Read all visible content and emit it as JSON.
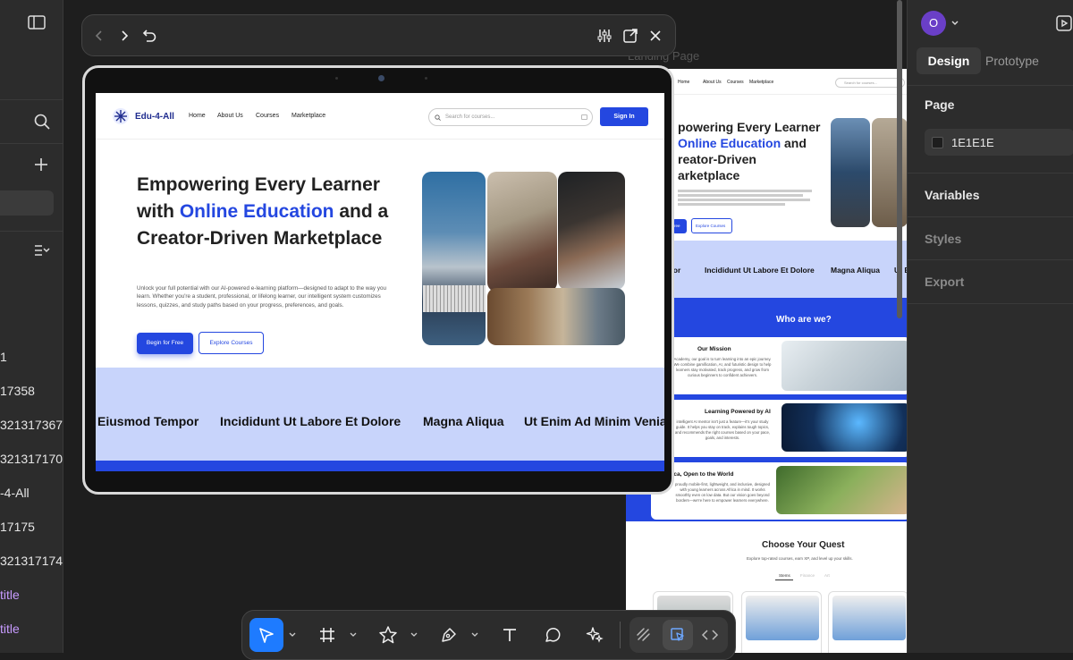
{
  "left_panel": {
    "layers": [
      {
        "label": "1",
        "purple": false
      },
      {
        "label": "17358",
        "purple": false
      },
      {
        "label": "321317367",
        "purple": false
      },
      {
        "label": "321317170",
        "purple": false
      },
      {
        "label": "-4-All",
        "purple": false
      },
      {
        "label": "17175",
        "purple": false
      },
      {
        "label": "321317174",
        "purple": false
      },
      {
        "label": "title",
        "purple": true
      },
      {
        "label": "title",
        "purple": true
      }
    ]
  },
  "device": {
    "site": {
      "logo": "Edu-4-All",
      "nav": [
        "Home",
        "About Us",
        "Courses",
        "Marketplace"
      ],
      "search_placeholder": "Search for courses...",
      "signin": "Sign In",
      "hero_title_part1": "Empowering Every Learner with ",
      "hero_title_accent": "Online Education",
      "hero_title_part2": " and a Creator-Driven Marketplace",
      "hero_desc": "Unlock your full potential with our AI-powered e-learning platform—designed to adapt to the way you learn. Whether you're a student, professional, or lifelong learner, our intelligent system customizes lessons, quizzes, and study paths based on your progress, preferences, and goals.",
      "btn_primary": "Begin for Free",
      "btn_secondary": "Explore Courses",
      "band": [
        "Eiusmod Tempor",
        "Incididunt Ut Labore Et Dolore",
        "Magna Aliqua",
        "Ut Enim Ad Minim Venia"
      ]
    }
  },
  "canvas": {
    "frame_label": "Landing Page",
    "preview": {
      "nav": [
        "Home",
        "About Us",
        "Courses",
        "Marketplace"
      ],
      "search_placeholder": "Search for courses...",
      "hero_line1": "powering Every Learner",
      "hero_line2_accent": "Online Education",
      "hero_line2_rest": " and",
      "hero_line3": "reator-Driven",
      "hero_line4": "arketplace",
      "btn_primary": "ree",
      "btn_secondary": "Explore Courses",
      "band": [
        "mpor",
        "Incididunt Ut Labore Et Dolore",
        "Magna Aliqua",
        "Ut E"
      ],
      "who_title": "Who are we?",
      "cards": [
        {
          "title": "Our Mission",
          "text": "Academy, our goal is to turn learning into an epic journey. We combine gamification, AI, and futuristic design to help learners stay motivated, track progress, and grow from curious beginners to confident achievers."
        },
        {
          "title": "Learning Powered by AI",
          "text": "intelligent AI mentor isn't just a feature—it's your study guide. It helps you stay on track, explains tough topics, and recommends the right courses based on your pace, goals, and interests."
        },
        {
          "title": "t for Africa, Open to the World",
          "text": "proudly mobile-first, lightweight, and inclusive, designed with young learners across Africa in mind. It works smoothly even on low data. But our vision goes beyond borders—we're here to empower learners everywhere."
        }
      ],
      "quest_title": "Choose Your Quest",
      "quest_sub": "Explore top-rated courses, earn XP, and level up your skills.",
      "quest_tabs": [
        "Stems",
        "Finance",
        "Art"
      ]
    }
  },
  "right_panel": {
    "avatar_letter": "O",
    "tabs": [
      "Design",
      "Prototype"
    ],
    "page_label": "Page",
    "page_color": "1E1E1E",
    "sections": [
      "Variables",
      "Styles",
      "Export"
    ]
  },
  "colors": {
    "accent": "#2447e0",
    "band": "#c8d4fb",
    "avatar": "#6a3fc7",
    "toolbar_active": "#1e7bff",
    "canvas_bg": "#1e1e1e"
  }
}
